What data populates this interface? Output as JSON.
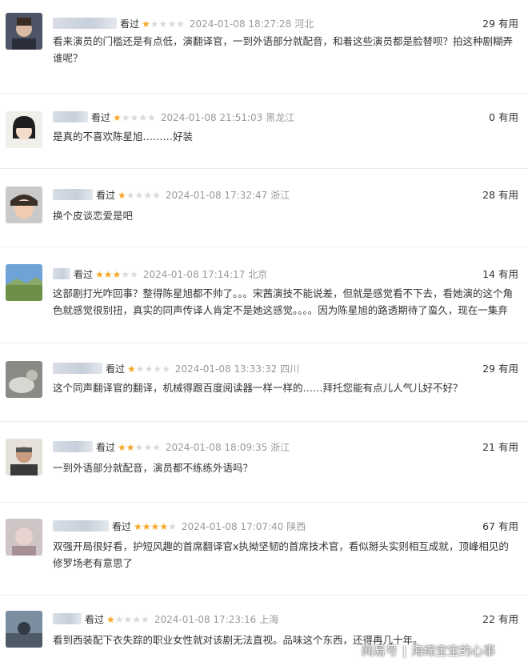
{
  "seen_label": "看过",
  "useful_suffix": "有用",
  "watermark": {
    "brand": "网易号",
    "separator": "|",
    "author": "海绵宝宝的心事"
  },
  "colors": {
    "star_on": "#f5a623",
    "star_off": "#d9d9d9",
    "meta_gray": "#9a9a9a"
  },
  "reviews": [
    {
      "stars": 1,
      "time": "2024-01-08 18:27:28",
      "location": "河北",
      "useful": "29",
      "text": "看来演员的门槛还是有点低，演翻译官，一到外语部分就配音，和着这些演员都是脸替呗？拍这种剧糊弄谁呢？"
    },
    {
      "stars": 1,
      "time": "2024-01-08 21:51:03",
      "location": "黑龙江",
      "useful": "0",
      "text": "是真的不喜欢陈星旭………好装"
    },
    {
      "stars": 1,
      "time": "2024-01-08 17:32:47",
      "location": "浙江",
      "useful": "28",
      "text": "换个皮谈恋爱是吧"
    },
    {
      "stars": 3,
      "time": "2024-01-08 17:14:17",
      "location": "北京",
      "useful": "14",
      "text": "这部剧打光咋回事？整得陈星旭都不帅了。。。宋茜演技不能说差，但就是感觉看不下去，看她演的这个角色就感觉很别扭，真实的同声传译人肯定不是她这感觉。。。。因为陈星旭的路透期待了蛮久，现在一集弃"
    },
    {
      "stars": 1,
      "time": "2024-01-08 13:33:32",
      "location": "四川",
      "useful": "29",
      "text": "这个同声翻译官的翻译，机械得跟百度阅读器一样一样的……拜托您能有点儿人气儿好不好？"
    },
    {
      "stars": 2,
      "time": "2024-01-08 18:09:35",
      "location": "浙江",
      "useful": "21",
      "text": "一到外语部分就配音，演员都不练练外语吗？"
    },
    {
      "stars": 4,
      "time": "2024-01-08 17:07:40",
      "location": "陕西",
      "useful": "67",
      "text": "双强开局很好看，护短风趣的首席翻译官x执拗坚韧的首席技术官，看似掰头实则相互成就，顶峰相见的修罗场老有意思了"
    },
    {
      "stars": 1,
      "time": "2024-01-08 17:23:16",
      "location": "上海",
      "useful": "22",
      "text": "看到西装配下衣失踪的职业女性就对该剧无法直视。品味这个东西，还得再几十年。"
    }
  ]
}
